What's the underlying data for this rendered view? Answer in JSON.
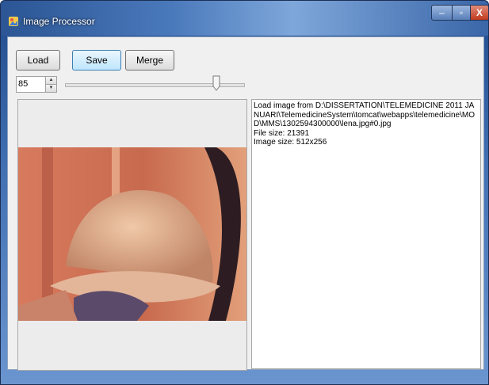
{
  "window": {
    "title": "Image Processor",
    "controls": {
      "minimize": "–",
      "maximize": "▫",
      "close": "X"
    }
  },
  "toolbar": {
    "load_label": "Load",
    "save_label": "Save",
    "merge_label": "Merge"
  },
  "numeric": {
    "value": "85",
    "up": "▲",
    "down": "▼"
  },
  "slider": {
    "level": 0.85
  },
  "picture": {
    "icon": "image-preview"
  },
  "info": {
    "text": "Load image from D:\\DISSERTATION\\TELEMEDICINE 2011 JANUARI\\TelemedicineSystem\\tomcat\\webapps\\telemedicine\\MOD\\MMS\\1302594300000\\lena.jpg#0.jpg\nFile size: 21391\nImage size: 512x256"
  },
  "colors": {
    "accent": "#3c7fb1",
    "title_bar": "#4a79bb",
    "close": "#c13a1c"
  }
}
